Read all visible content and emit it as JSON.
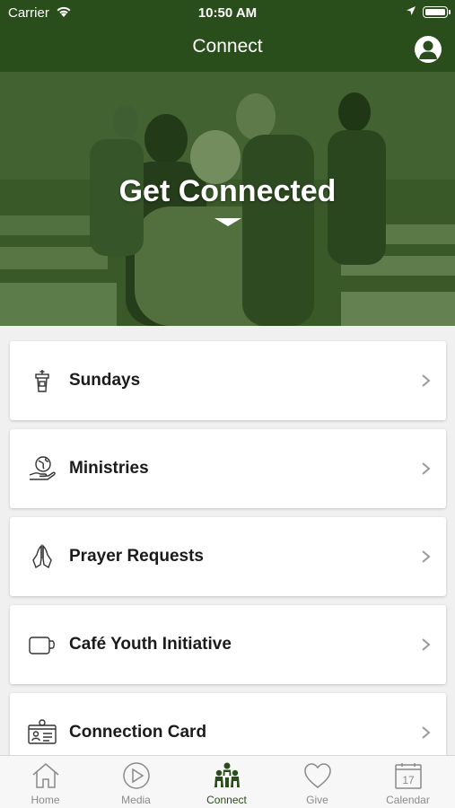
{
  "status_bar": {
    "carrier": "Carrier",
    "time": "10:50 AM"
  },
  "header": {
    "title": "Connect"
  },
  "hero": {
    "title": "Get Connected"
  },
  "items": [
    {
      "label": "Sundays",
      "icon": "pulpit-icon"
    },
    {
      "label": "Ministries",
      "icon": "globe-hand-icon"
    },
    {
      "label": "Prayer Requests",
      "icon": "praying-hands-icon"
    },
    {
      "label": "Café Youth Initiative",
      "icon": "coffee-mug-icon"
    },
    {
      "label": "Connection Card",
      "icon": "id-card-icon"
    }
  ],
  "tabs": [
    {
      "label": "Home",
      "icon": "home-icon",
      "active": false
    },
    {
      "label": "Media",
      "icon": "play-icon",
      "active": false
    },
    {
      "label": "Connect",
      "icon": "people-icon",
      "active": true
    },
    {
      "label": "Give",
      "icon": "heart-icon",
      "active": false
    },
    {
      "label": "Calendar",
      "icon": "calendar-icon",
      "active": false,
      "badge": "17"
    }
  ],
  "colors": {
    "brand": "#2a4d1c",
    "tab_inactive": "#8a8a8a",
    "background": "#f0f0f0"
  }
}
